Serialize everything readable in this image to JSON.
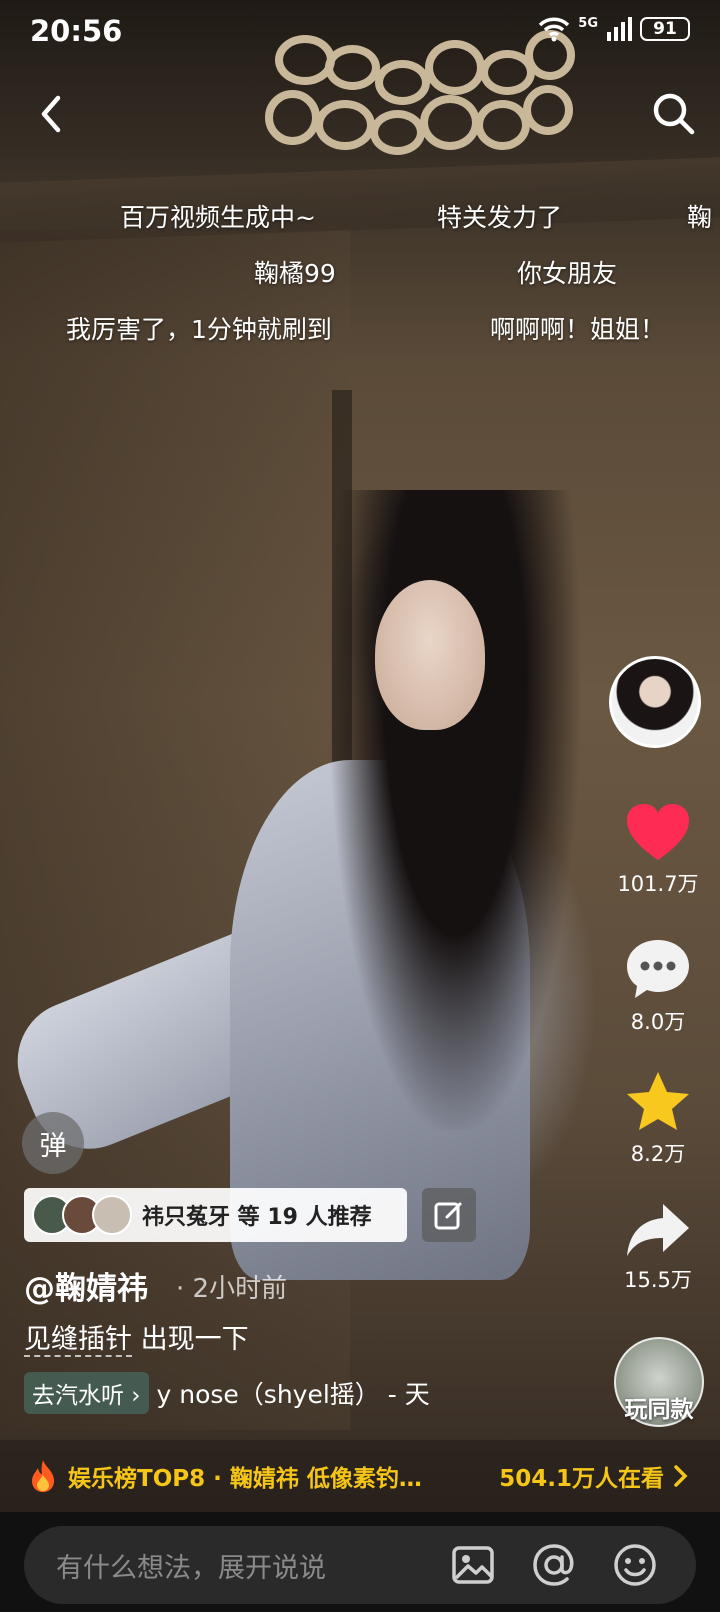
{
  "status_bar": {
    "time": "20:56",
    "network": "5G",
    "battery": "91"
  },
  "danmaku": [
    "百万视频生成中~",
    "特关发力了",
    "鞠",
    "鞠橘99",
    "你女朋友",
    "我厉害了，1分钟就刷到",
    "啊啊啊！姐姐！"
  ],
  "actions": {
    "likes": "101.7万",
    "comments": "8.0万",
    "favorites": "8.2万",
    "shares": "15.5万"
  },
  "danmaku_toggle": "弹",
  "recommend": {
    "text": "祎只菟牙 等 19 人推荐"
  },
  "author": {
    "handle": "@鞠婧祎",
    "time_ago": "· 2小时前"
  },
  "caption": {
    "topic": "见缝插针",
    "text": " 出现一下"
  },
  "music": {
    "tag": "去汽水听 ›",
    "title": "y nose（shyel摇） - 天"
  },
  "play_same": "玩同款",
  "hot_bar": {
    "left": "娱乐榜TOP8 · 鞠婧祎 低像素钓…",
    "right": "504.1万人在看"
  },
  "comment_input": {
    "placeholder": "有什么想法，展开说说"
  },
  "colors": {
    "accent_yellow": "#f5c518",
    "like_red": "#fe2c55",
    "star_yellow": "#f8c81e"
  }
}
